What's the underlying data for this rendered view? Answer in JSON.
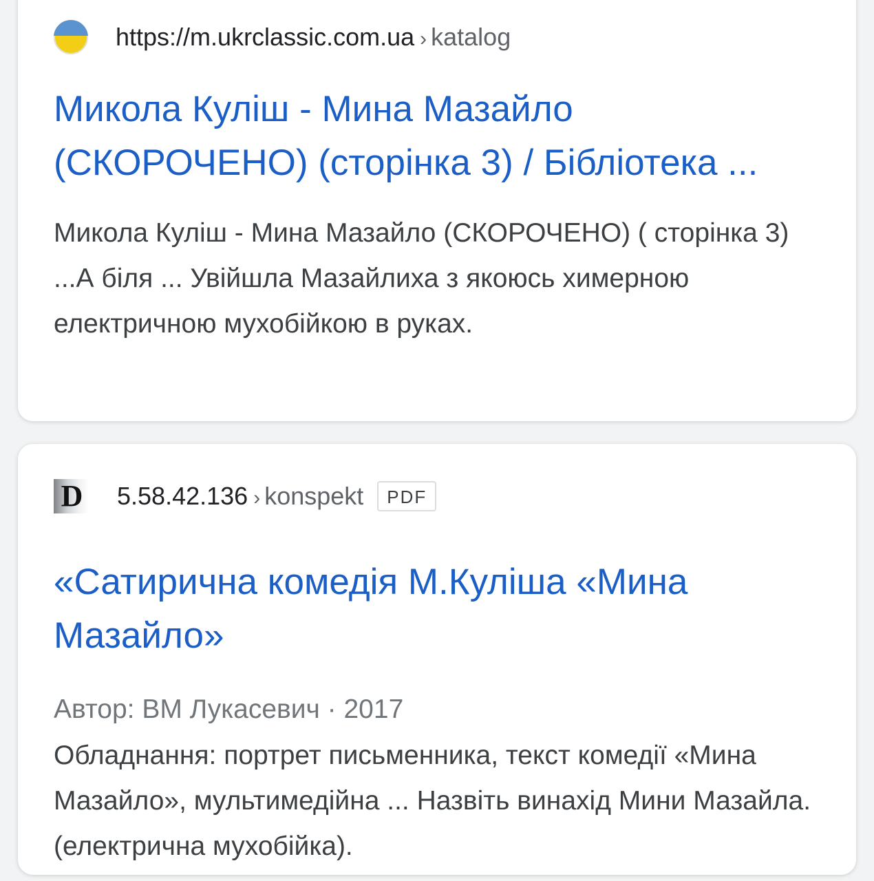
{
  "results": [
    {
      "favicon": "ukraine-flag-icon",
      "url_domain": "https://m.ukrclassic.com.ua",
      "url_separator": "›",
      "url_path": "katalog",
      "title": "Микола Куліш - Мина Мазайло (СКОРОЧЕНО) (сторінка 3) / Бібліотека ...",
      "snippet": "Микола Куліш - Мина Мазайло (СКОРОЧЕНО) ( сторінка 3) ...А біля ... Увійшла Мазайлиха з якоюсь химерною електричною мухобійкою в руках."
    },
    {
      "favicon": "d-letter-icon",
      "favicon_letter": "D",
      "url_domain": "5.58.42.136",
      "url_separator": "›",
      "url_path": "konspekt",
      "badge": "PDF",
      "title": "«Сатирична комедія М.Куліша «Мина Мазайло»",
      "meta": "Автор: ВМ Лукасевич · 2017",
      "snippet": "Обладнання: портрет письменника, текст комедії «Мина Мазайло», мультимедійна ... Назвіть винахід Мини Мазайла. (електрична мухобійка)."
    }
  ],
  "colors": {
    "title_link": "#1a5ec6",
    "snippet_text": "#3c4043",
    "meta_text": "#70757a",
    "page_background": "#f1f3f4",
    "card_background": "#ffffff"
  }
}
